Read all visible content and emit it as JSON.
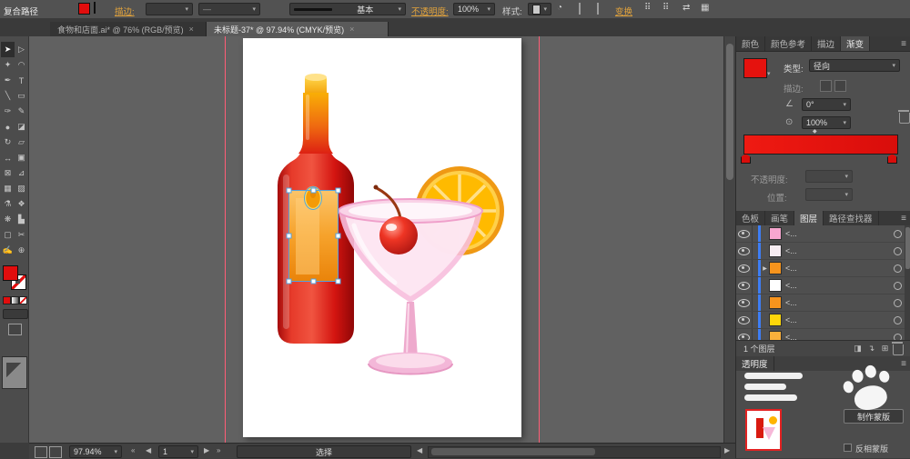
{
  "icons": {
    "dropdown": "▾",
    "close": "×",
    "menu": "≡",
    "prev": "◀",
    "next": "▶",
    "first": "«",
    "last": "»",
    "angle": "∠",
    "aspect": "⊙",
    "recolor": "◔",
    "grid": "⠿",
    "shuffle": "⇄",
    "panel": "▦",
    "diamond": "◆",
    "clip": "◨",
    "sublayer": "↴",
    "new_layer": "⊞",
    "line": "—"
  },
  "top_bar": {
    "left_label": "复合路径",
    "stroke_label": "描边:",
    "brush_name": "基本",
    "opacity_label": "不透明度:",
    "opacity_value": "100%",
    "style_label": "样式:",
    "transform_label": "变换"
  },
  "doc_tabs": [
    {
      "label": "食物和店面.ai* @ 76% (RGB/预览)"
    },
    {
      "label": "未标题-37* @ 97.94% (CMYK/预览)"
    }
  ],
  "toolbar": {
    "tools": [
      {
        "name": "selection",
        "glyph": "➤"
      },
      {
        "name": "direct-selection",
        "glyph": "▷"
      },
      {
        "name": "magic-wand",
        "glyph": "✦"
      },
      {
        "name": "lasso",
        "glyph": "◠"
      },
      {
        "name": "pen",
        "glyph": "✒"
      },
      {
        "name": "type",
        "glyph": "T"
      },
      {
        "name": "line-segment",
        "glyph": "╲"
      },
      {
        "name": "rectangle",
        "glyph": "▭"
      },
      {
        "name": "paintbrush",
        "glyph": "✑"
      },
      {
        "name": "pencil",
        "glyph": "✎"
      },
      {
        "name": "blob-brush",
        "glyph": "●"
      },
      {
        "name": "eraser",
        "glyph": "◪"
      },
      {
        "name": "rotate",
        "glyph": "↻"
      },
      {
        "name": "scale",
        "glyph": "▱"
      },
      {
        "name": "width",
        "glyph": "↔"
      },
      {
        "name": "free-transform",
        "glyph": "▣"
      },
      {
        "name": "shape-builder",
        "glyph": "⊠"
      },
      {
        "name": "perspective-grid",
        "glyph": "⊿"
      },
      {
        "name": "mesh",
        "glyph": "▦"
      },
      {
        "name": "gradient",
        "glyph": "▨"
      },
      {
        "name": "eyedropper",
        "glyph": "⚗"
      },
      {
        "name": "blend",
        "glyph": "❖"
      },
      {
        "name": "symbol-sprayer",
        "glyph": "❋"
      },
      {
        "name": "column-graph",
        "glyph": "▙"
      },
      {
        "name": "artboard",
        "glyph": "▢"
      },
      {
        "name": "slice",
        "glyph": "✂"
      },
      {
        "name": "hand",
        "glyph": "✍"
      },
      {
        "name": "zoom",
        "glyph": "⊕"
      }
    ]
  },
  "panels": {
    "group1": {
      "tabs": [
        "颜色",
        "颜色参考",
        "描边",
        "渐变"
      ]
    },
    "gradient": {
      "type_label": "类型:",
      "type_value": "径向",
      "stroke_label": "描边:",
      "angle_value": "0°",
      "aspect_value": "100%",
      "opacity_label": "不透明度:",
      "location_label": "位置:"
    },
    "group2": {
      "tabs": [
        "色板",
        "画笔",
        "图层",
        "路径查找器"
      ]
    },
    "layers": {
      "rows": [
        {
          "name": "<...",
          "color": "#f7a6cf"
        },
        {
          "name": "<...",
          "color": "#f6ecf1"
        },
        {
          "name": "<...",
          "color": "#f7941d",
          "expand": "▶"
        },
        {
          "name": "<...",
          "color": "#ffffff"
        },
        {
          "name": "<...",
          "color": "#f7941d"
        },
        {
          "name": "<...",
          "color": "#ffd70a"
        },
        {
          "name": "<...",
          "color": "#fbb03b"
        }
      ],
      "footer": "1 个图层"
    },
    "transparency": {
      "title": "透明度",
      "make_mask": "制作蒙版",
      "invert_mask": "反相蒙版"
    }
  },
  "status_bar": {
    "zoom": "97.94%",
    "artboard": "1",
    "tool_status": "选择"
  },
  "colors": {
    "gradient_red": "#e5120e",
    "fill_red": "#e10d0d",
    "selection_blue": "#55a0dc",
    "layer_color_blue": "#3d7ef5",
    "link_amber": "#e2a33c"
  }
}
